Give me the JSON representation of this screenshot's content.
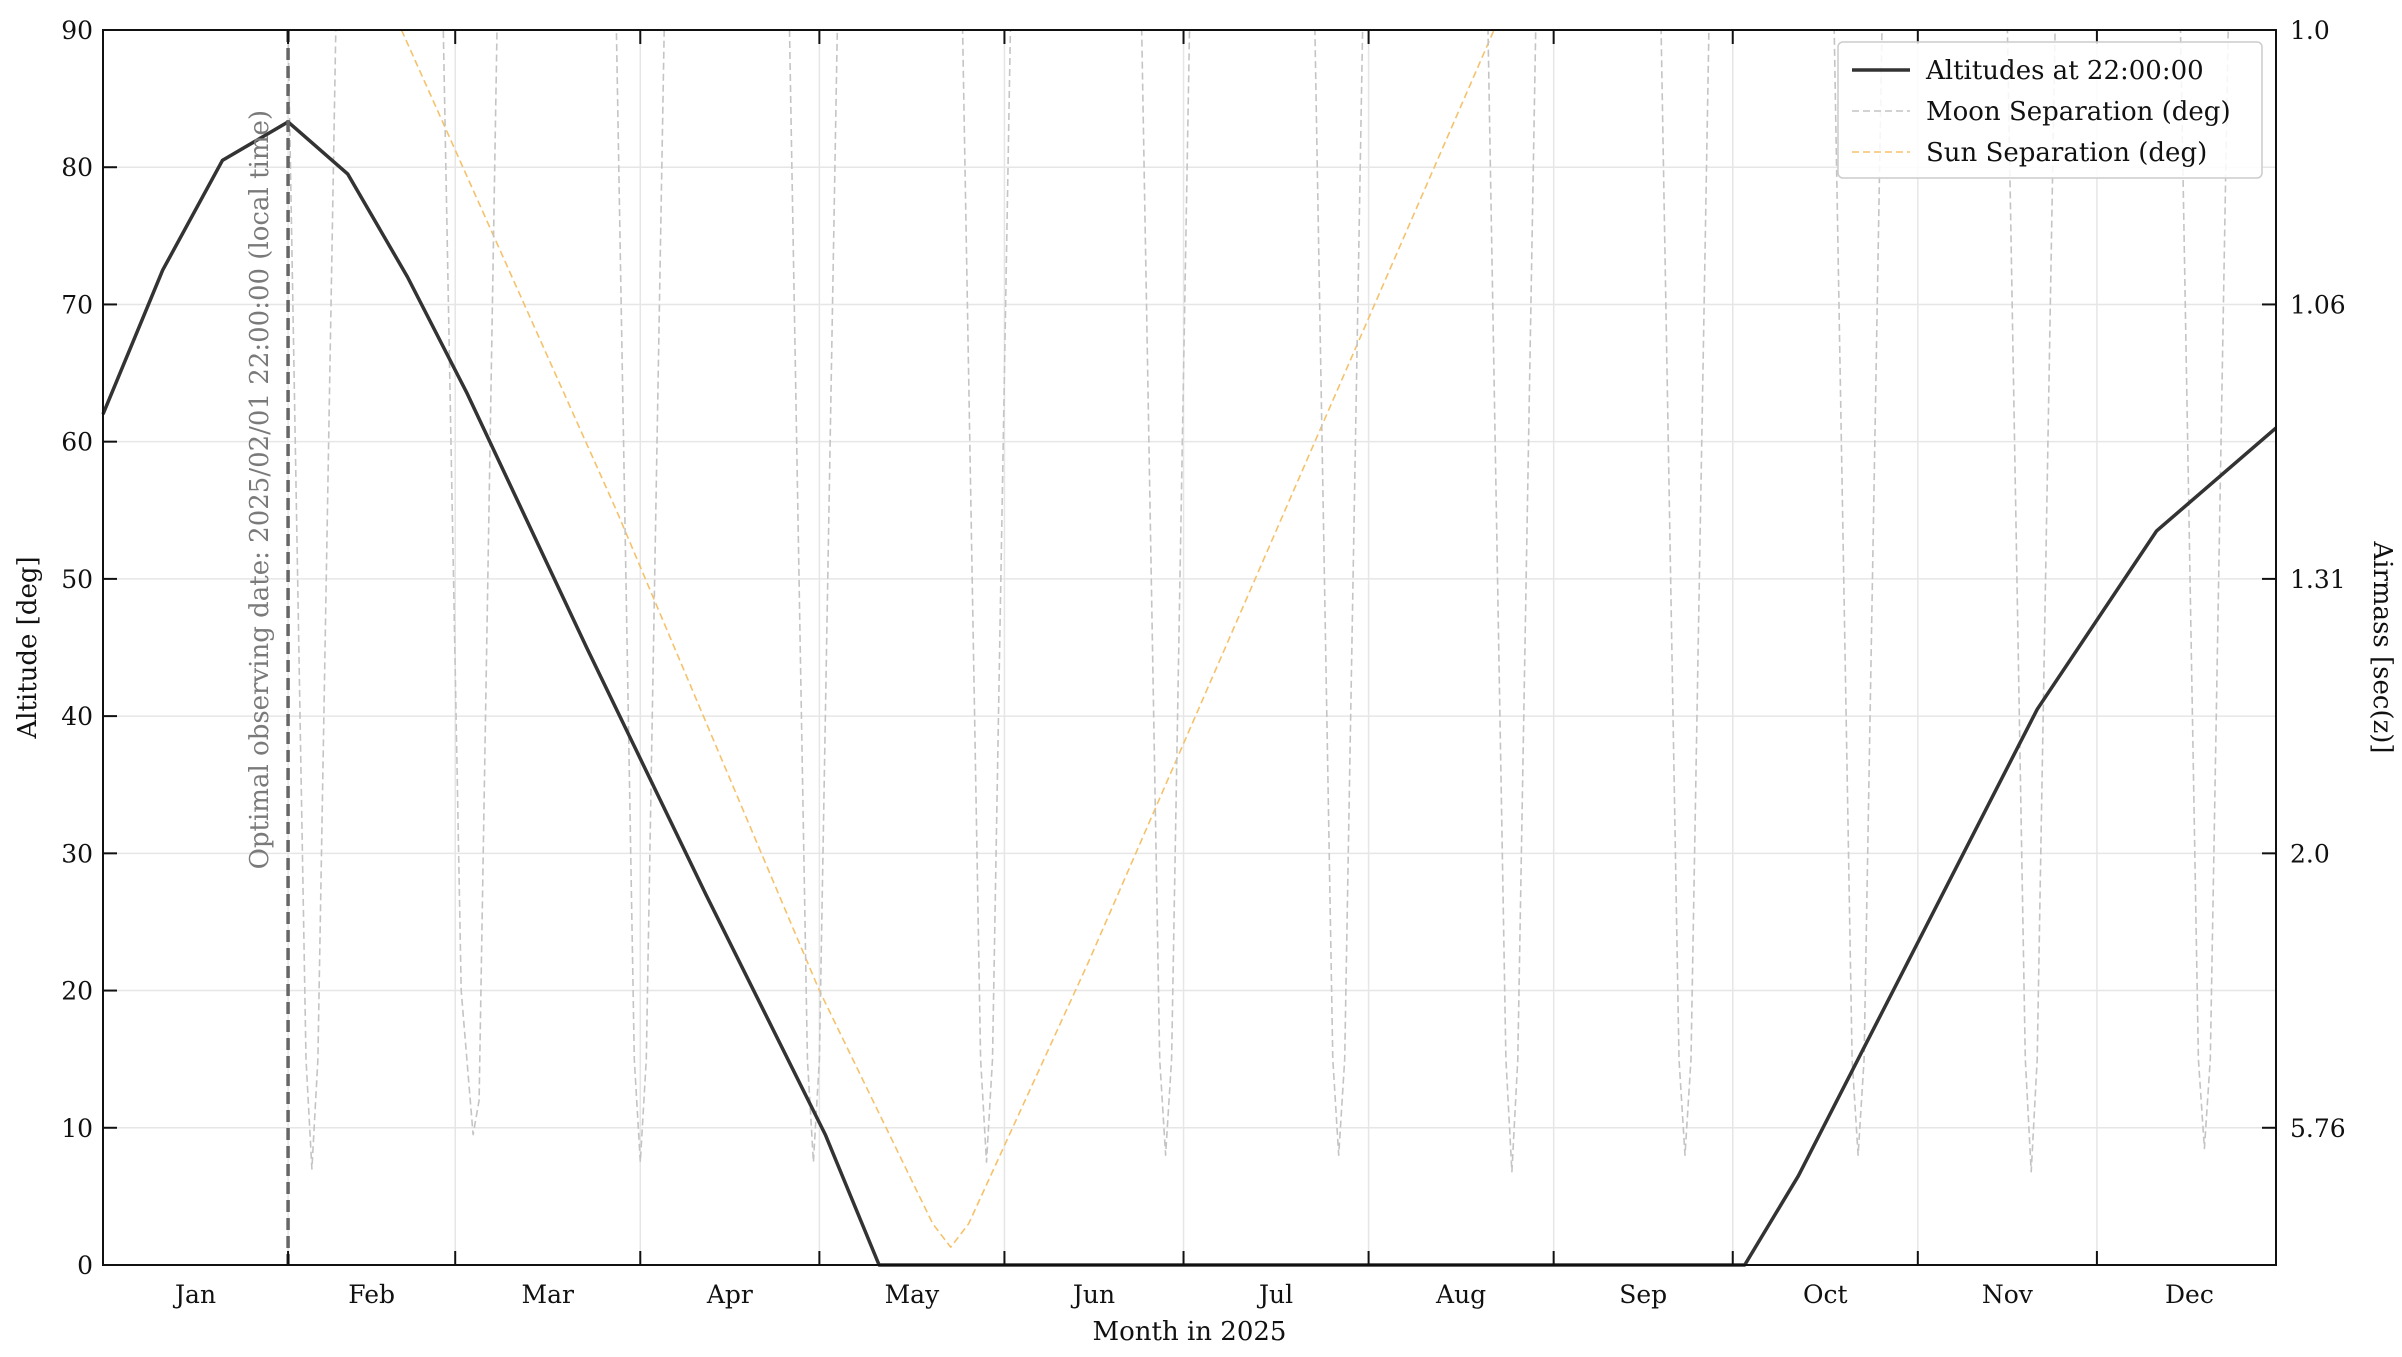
{
  "chart_data": {
    "type": "line",
    "title": "",
    "xlabel": "Month in 2025",
    "ylabel": "Altitude [deg]",
    "y2label": "Airmass [sec(z)]",
    "xlim": [
      "2025-01-01",
      "2025-12-31"
    ],
    "ylim": [
      0,
      90
    ],
    "grid": true,
    "legend_position": "top-right",
    "x_ticks": [
      "Jan",
      "Feb",
      "Mar",
      "Apr",
      "May",
      "Jun",
      "Jul",
      "Aug",
      "Sep",
      "Oct",
      "Nov",
      "Dec"
    ],
    "y_ticks": [
      0,
      10,
      20,
      30,
      40,
      50,
      60,
      70,
      80,
      90
    ],
    "y2_ticks": [
      {
        "altitude": 10,
        "label": "5.76"
      },
      {
        "altitude": 30,
        "label": "2.0"
      },
      {
        "altitude": 50,
        "label": "1.31"
      },
      {
        "altitude": 70,
        "label": "1.06"
      },
      {
        "altitude": 90,
        "label": "1.0"
      }
    ],
    "annotation": {
      "text": "Optimal observing date: 2025/02/01 22:00:00 (local time)",
      "date": "2025-02-01",
      "color": "#666666"
    },
    "series": [
      {
        "name": "Altitudes at 22:00:00",
        "color": "#333333",
        "style": "solid",
        "points": [
          [
            "2025-01-01",
            62
          ],
          [
            "2025-01-11",
            72.5
          ],
          [
            "2025-01-21",
            80.5
          ],
          [
            "2025-02-01",
            83.3
          ],
          [
            "2025-02-11",
            79.5
          ],
          [
            "2025-02-21",
            72
          ],
          [
            "2025-03-03",
            63.5
          ],
          [
            "2025-03-23",
            45
          ],
          [
            "2025-04-12",
            27
          ],
          [
            "2025-05-02",
            9.5
          ],
          [
            "2025-05-11",
            0
          ],
          [
            "2025-10-03",
            0
          ],
          [
            "2025-10-12",
            6.5
          ],
          [
            "2025-11-01",
            23.5
          ],
          [
            "2025-11-21",
            40.5
          ],
          [
            "2025-12-11",
            53.5
          ],
          [
            "2025-12-31",
            61
          ]
        ]
      },
      {
        "name": "Moon Separation (deg)",
        "color": "#c4c4c4",
        "style": "dashed",
        "points": [
          [
            "2025-02-01",
            90
          ],
          [
            "2025-02-04",
            15
          ],
          [
            "2025-02-05",
            7
          ],
          [
            "2025-02-06",
            15
          ],
          [
            "2025-02-09",
            90
          ],
          [
            "2025-02-27",
            90
          ],
          [
            "2025-03-02",
            20
          ],
          [
            "2025-03-04",
            9.5
          ],
          [
            "2025-03-05",
            12
          ],
          [
            "2025-03-08",
            90
          ],
          [
            "2025-03-28",
            90
          ],
          [
            "2025-03-31",
            15
          ],
          [
            "2025-04-01",
            7.5
          ],
          [
            "2025-04-02",
            15
          ],
          [
            "2025-04-05",
            90
          ],
          [
            "2025-04-26",
            90
          ],
          [
            "2025-04-29",
            15
          ],
          [
            "2025-04-30",
            7.5
          ],
          [
            "2025-05-01",
            15
          ],
          [
            "2025-05-04",
            90
          ],
          [
            "2025-05-25",
            90
          ],
          [
            "2025-05-28",
            15
          ],
          [
            "2025-05-29",
            7.5
          ],
          [
            "2025-05-30",
            15
          ],
          [
            "2025-06-02",
            90
          ],
          [
            "2025-06-24",
            90
          ],
          [
            "2025-06-27",
            15
          ],
          [
            "2025-06-28",
            8
          ],
          [
            "2025-06-29",
            15
          ],
          [
            "2025-07-02",
            90
          ],
          [
            "2025-07-23",
            90
          ],
          [
            "2025-07-26",
            15
          ],
          [
            "2025-07-27",
            8
          ],
          [
            "2025-07-28",
            15
          ],
          [
            "2025-07-31",
            90
          ],
          [
            "2025-08-21",
            90
          ],
          [
            "2025-08-24",
            15
          ],
          [
            "2025-08-25",
            6.8
          ],
          [
            "2025-08-26",
            15
          ],
          [
            "2025-08-29",
            90
          ],
          [
            "2025-09-19",
            90
          ],
          [
            "2025-09-22",
            15
          ],
          [
            "2025-09-23",
            8
          ],
          [
            "2025-09-24",
            15
          ],
          [
            "2025-09-27",
            90
          ],
          [
            "2025-10-18",
            90
          ],
          [
            "2025-10-21",
            15
          ],
          [
            "2025-10-22",
            8
          ],
          [
            "2025-10-23",
            15
          ],
          [
            "2025-10-26",
            90
          ],
          [
            "2025-11-16",
            90
          ],
          [
            "2025-11-19",
            15
          ],
          [
            "2025-11-20",
            6.8
          ],
          [
            "2025-11-21",
            15
          ],
          [
            "2025-11-24",
            90
          ],
          [
            "2025-12-15",
            90
          ],
          [
            "2025-12-18",
            15
          ],
          [
            "2025-12-19",
            8.5
          ],
          [
            "2025-12-20",
            15
          ],
          [
            "2025-12-23",
            90
          ]
        ]
      },
      {
        "name": "Sun Separation (deg)",
        "color": "#f5c26b",
        "style": "dashed",
        "points": [
          [
            "2025-02-20",
            90
          ],
          [
            "2025-03-28",
            55
          ],
          [
            "2025-05-01",
            20
          ],
          [
            "2025-05-20",
            3
          ],
          [
            "2025-05-23",
            1.3
          ],
          [
            "2025-05-26",
            3
          ],
          [
            "2025-06-15",
            22
          ],
          [
            "2025-07-20",
            57
          ],
          [
            "2025-08-22",
            90
          ]
        ]
      }
    ]
  }
}
